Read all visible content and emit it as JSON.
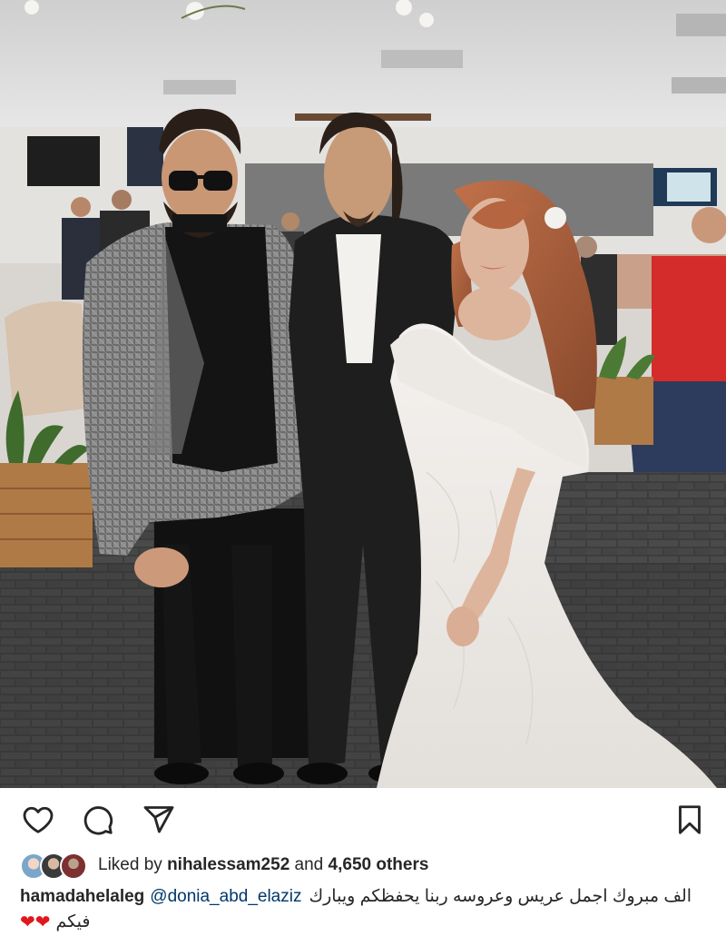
{
  "post": {
    "image_alt": "Wedding photo of a bride in a white gown with two men in suits",
    "actions": {
      "like_icon": "heart-outline-icon",
      "comment_icon": "comment-bubble-icon",
      "share_icon": "paper-plane-icon",
      "save_icon": "bookmark-icon"
    },
    "likes": {
      "prefix": "Liked by",
      "user": "nihalessam252",
      "middle": "and",
      "count": "4,650 others"
    },
    "caption": {
      "username": "hamadahelaleg",
      "mention": "@donia_abd_elaziz",
      "text_ar": "الف مبروك اجمل عريس وعروسه ربنا يحفظكم ويبارك",
      "text_ar2": "فيكم",
      "emoji": "❤❤"
    }
  },
  "colors": {
    "mention": "#00376b",
    "heart": "#e1171e",
    "text": "#262626"
  }
}
